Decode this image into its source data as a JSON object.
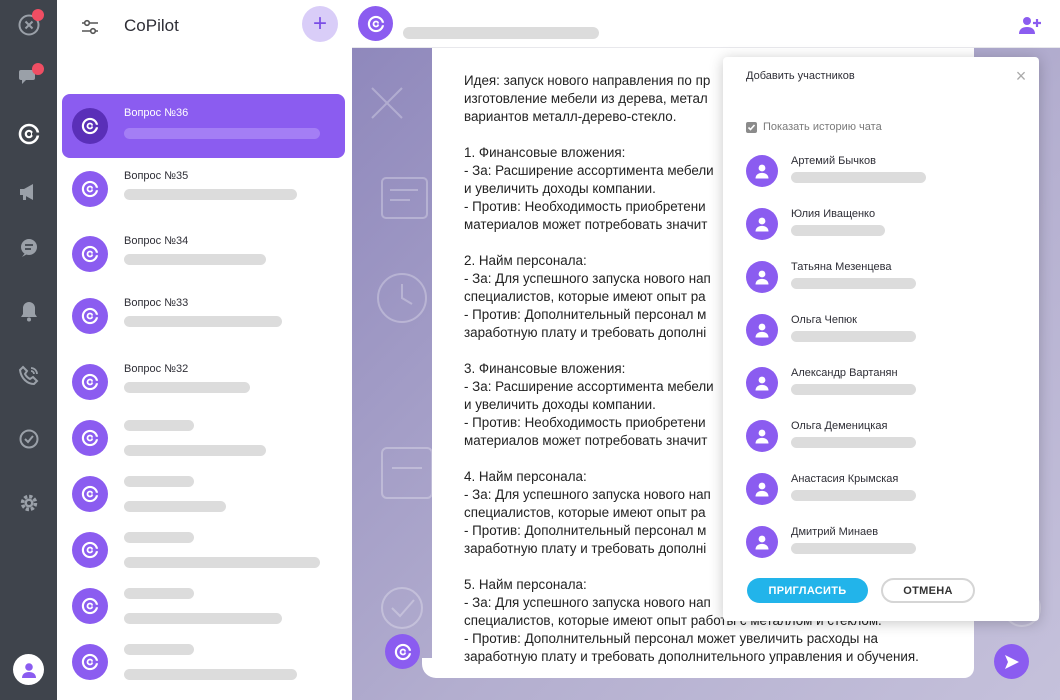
{
  "app": {
    "title": "CoPilot"
  },
  "rail": {
    "icons": [
      "close-circle-icon",
      "chat-bubbles-icon",
      "copilot-logo-icon",
      "megaphone-icon",
      "chat-list-icon",
      "bell-icon",
      "phone-icon",
      "check-circle-icon",
      "gear-icon",
      "user-icon"
    ],
    "colors": {
      "rail_bg": "#3f444c",
      "notification": "#f04e63"
    }
  },
  "chat_list": {
    "add_label": "+",
    "items": [
      {
        "name": "Вопрос №36",
        "active": true
      },
      {
        "name": "Вопрос №35",
        "active": false
      },
      {
        "name": "Вопрос №34",
        "active": false
      },
      {
        "name": "Вопрос №33",
        "active": false
      },
      {
        "name": "Вопрос №32",
        "active": false
      },
      {
        "name": "",
        "active": false
      },
      {
        "name": "",
        "active": false
      },
      {
        "name": "",
        "active": false
      },
      {
        "name": "",
        "active": false
      },
      {
        "name": "",
        "active": false
      }
    ]
  },
  "message": {
    "text": "Идея: запуск нового направления по пр\nизготовление мебели из дерева, метал\nвариантов металл-дерево-стекло.\n\n1. Финансовые вложения:\n- За: Расширение ассортимента мебели\nи увеличить доходы компании.\n- Против: Необходимость приобретени\nматериалов может потребовать значит\n\n2. Найм персонала:\n- За: Для успешного запуска нового нап\nспециалистов, которые имеют опыт ра\n- Против: Дополнительный персонал м\nзаработную плату и требовать дополні\n\n3. Финансовые вложения:\n- За: Расширение ассортимента мебели\nи увеличить доходы компании.\n- Против: Необходимость приобретени\nматериалов может потребовать значит\n\n4. Найм персонала:\n- За: Для успешного запуска нового нап\nспециалистов, которые имеют опыт ра\n- Против: Дополнительный персонал м\nзаработную плату и требовать дополні\n\n5. Найм персонала:\n- За: Для успешного запуска нового нап\nспециалистов, которые имеют опыт работы с металлом и стеклом.\n- Против: Дополнительный персонал может увеличить расходы на\nзаработную плату и требовать дополнительного управления и обучения."
  },
  "modal": {
    "title": "Добавить участников",
    "close_label": "×",
    "show_history_label": "Показать историю чата",
    "show_history_checked": true,
    "participants": [
      {
        "name": "Артемий Бычков"
      },
      {
        "name": "Юлия Иващенко"
      },
      {
        "name": "Татьяна Мезенцева"
      },
      {
        "name": "Ольга Чепюк"
      },
      {
        "name": "Александр Вартанян"
      },
      {
        "name": "Ольга Деменицкая"
      },
      {
        "name": "Анастасия Крымская"
      },
      {
        "name": "Дмитрий Минаев"
      }
    ],
    "invite_label": "ПРИГЛАСИТЬ",
    "cancel_label": "ОТМЕНА"
  },
  "colors": {
    "accent": "#8b5cf0",
    "invite": "#22b4ea"
  }
}
